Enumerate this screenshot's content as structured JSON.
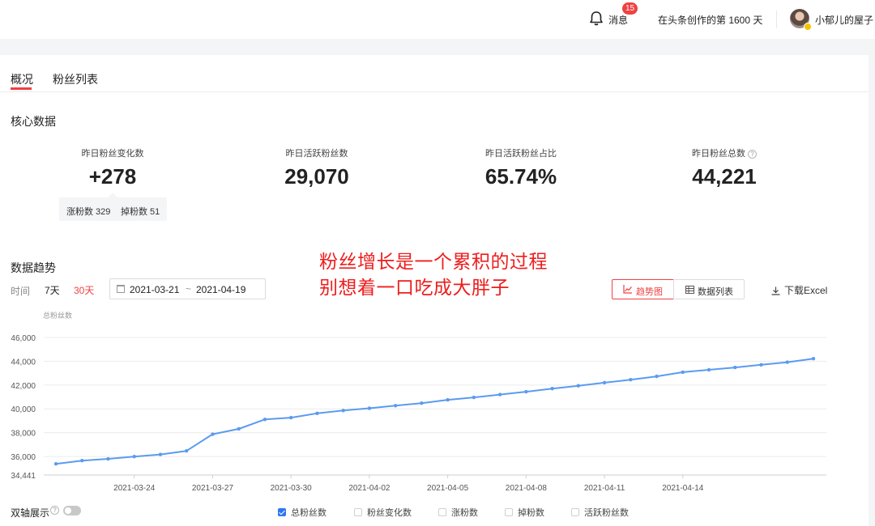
{
  "header": {
    "messages_label": "消息",
    "messages_badge": "15",
    "creation_days": "在头条创作的第 1600 天",
    "user_name": "小郁儿的屋子"
  },
  "tabs": [
    {
      "label": "概况",
      "active": true
    },
    {
      "label": "粉丝列表",
      "active": false
    }
  ],
  "core": {
    "title": "核心数据",
    "stats": [
      {
        "label": "昨日粉丝变化数",
        "value": "+278"
      },
      {
        "label": "昨日活跃粉丝数",
        "value": "29,070"
      },
      {
        "label": "昨日活跃粉丝占比",
        "value": "65.74%"
      },
      {
        "label": "昨日粉丝总数",
        "value": "44,221"
      }
    ],
    "sub": {
      "gain": "涨粉数 329",
      "loss": "掉粉数 51"
    },
    "info_glyph": "?"
  },
  "annotation": {
    "line1": "粉丝增长是一个累积的过程",
    "line2": "别想着一口吃成大胖子"
  },
  "trend": {
    "title": "数据趋势",
    "time_label": "时间",
    "range_7": "7天",
    "range_30": "30天",
    "date_from": "2021-03-21",
    "date_sep": "~",
    "date_to": "2021-04-19",
    "view_chart": "趋势图",
    "view_table": "数据列表",
    "download": "下载Excel",
    "y_title": "总粉丝数"
  },
  "legend": {
    "dual_axis": "双轴展示",
    "dual_axis_on": false,
    "help_glyph": "?",
    "items": [
      {
        "label": "总粉丝数",
        "checked": true
      },
      {
        "label": "粉丝变化数",
        "checked": false
      },
      {
        "label": "涨粉数",
        "checked": false
      },
      {
        "label": "掉粉数",
        "checked": false
      },
      {
        "label": "活跃粉丝数",
        "checked": false
      }
    ]
  },
  "chart_data": {
    "type": "line",
    "ylabel": "总粉丝数",
    "color": "#5b9bef",
    "yticks": [
      34441,
      36000,
      38000,
      40000,
      42000,
      44000,
      46000
    ],
    "ytick_labels": [
      "34,441",
      "36,000",
      "38,000",
      "40,000",
      "42,000",
      "44,000",
      "46,000"
    ],
    "xtick_labels": [
      "2021-03-24",
      "2021-03-27",
      "2021-03-30",
      "2021-04-02",
      "2021-04-05",
      "2021-04-08",
      "2021-04-11",
      "2021-04-14"
    ],
    "ylim": [
      34441,
      46000
    ],
    "series": [
      {
        "name": "总粉丝数",
        "x": [
          "2021-03-21",
          "2021-03-22",
          "2021-03-23",
          "2021-03-24",
          "2021-03-25",
          "2021-03-26",
          "2021-03-27",
          "2021-03-28",
          "2021-03-29",
          "2021-03-30",
          "2021-03-31",
          "2021-04-01",
          "2021-04-02",
          "2021-04-03",
          "2021-04-04",
          "2021-04-05",
          "2021-04-06",
          "2021-04-07",
          "2021-04-08",
          "2021-04-09",
          "2021-04-10",
          "2021-04-11",
          "2021-04-12",
          "2021-04-13",
          "2021-04-14",
          "2021-04-15",
          "2021-04-16",
          "2021-04-17",
          "2021-04-18",
          "2021-04-19"
        ],
        "values": [
          35380,
          35650,
          35800,
          35990,
          36170,
          36470,
          37870,
          38320,
          39110,
          39260,
          39620,
          39860,
          40050,
          40270,
          40480,
          40760,
          40960,
          41200,
          41440,
          41700,
          41940,
          42200,
          42450,
          42730,
          43080,
          43280,
          43480,
          43700,
          43920,
          44221
        ]
      }
    ]
  }
}
